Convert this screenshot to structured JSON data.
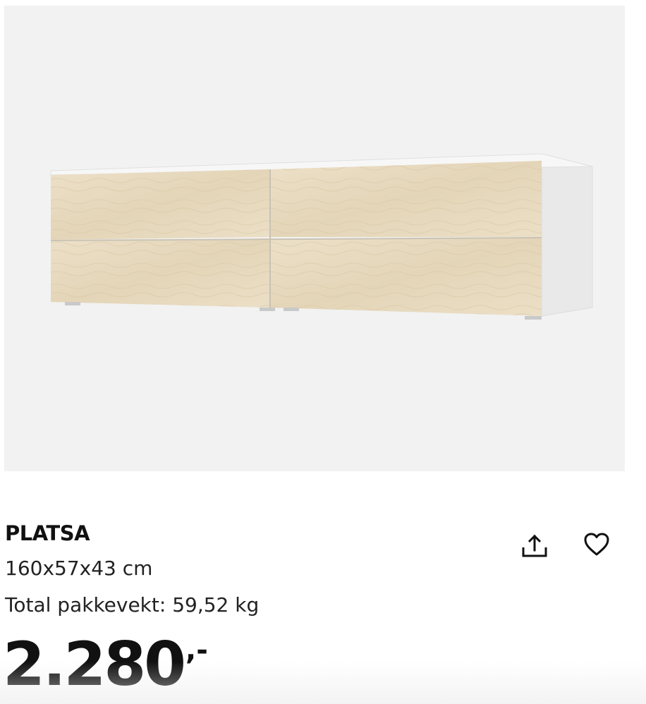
{
  "product": {
    "image_alt": "PLATSA chest of drawers, white with birch-effect drawer fronts",
    "name": "PLATSA",
    "dimensions": "160x57x43 cm",
    "weight_text": "Total pakkevekt: 59,52 kg",
    "price_integer": "2.280",
    "price_suffix": ",-"
  },
  "actions": {
    "share_icon": "share-icon",
    "favorite_icon": "heart-icon"
  },
  "colors": {
    "image_background": "#f2f2f2",
    "drawer_front": "#e9dcc2",
    "frame": "#e6e6e6",
    "text": "#111111"
  }
}
